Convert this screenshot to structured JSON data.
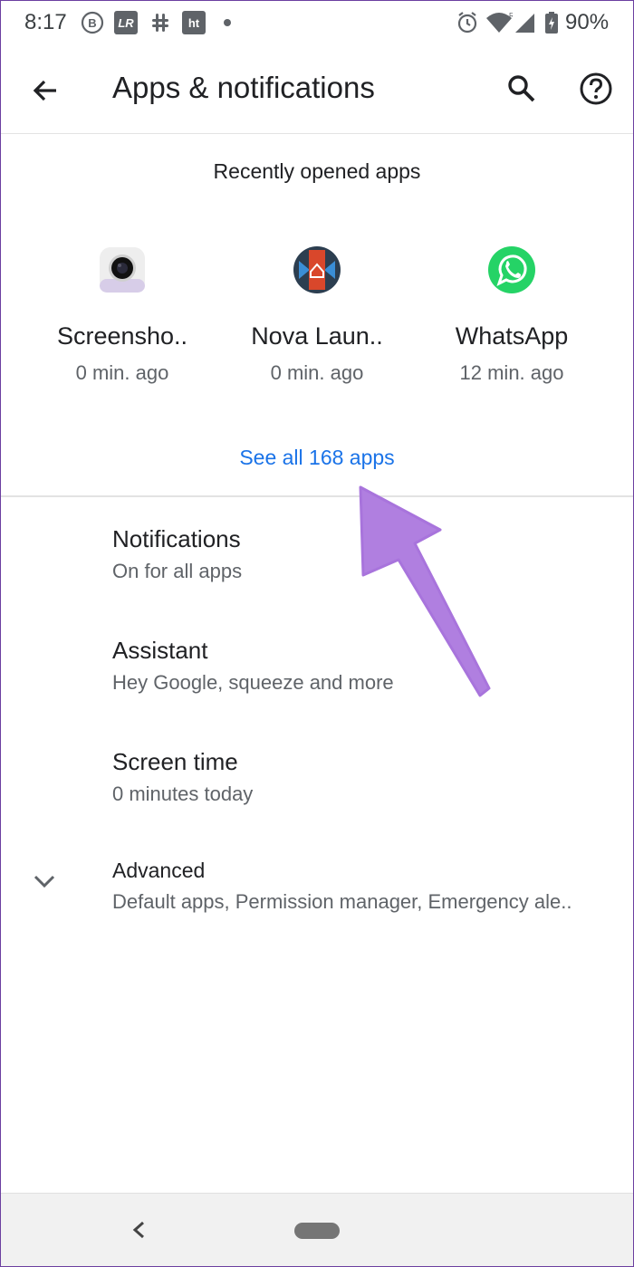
{
  "status_bar": {
    "time": "8:17",
    "badge_lr": "LR",
    "badge_ht": "ht",
    "battery": "90%",
    "icons": [
      "b-circle-icon",
      "lightroom-icon",
      "slack-icon",
      "ht-icon",
      "dot-icon",
      "alarm-icon",
      "wifi-icon",
      "signal-icon",
      "battery-icon"
    ]
  },
  "app_bar": {
    "title": "Apps & notifications",
    "icons": [
      "back-arrow-icon",
      "search-icon",
      "help-icon"
    ]
  },
  "recent": {
    "heading": "Recently opened apps",
    "apps": [
      {
        "name": "Screensho..",
        "time": "0 min. ago",
        "icon": "screenshot-app-icon"
      },
      {
        "name": "Nova Laun..",
        "time": "0 min. ago",
        "icon": "nova-launcher-icon"
      },
      {
        "name": "WhatsApp",
        "time": "12 min. ago",
        "icon": "whatsapp-icon"
      }
    ],
    "see_all": "See all 168 apps"
  },
  "settings": [
    {
      "title": "Notifications",
      "subtitle": "On for all apps"
    },
    {
      "title": "Assistant",
      "subtitle": "Hey Google, squeeze and more"
    },
    {
      "title": "Screen time",
      "subtitle": "0 minutes today"
    },
    {
      "title": "Advanced",
      "subtitle": "Default apps, Permission manager, Emergency ale.."
    }
  ],
  "annotation": {
    "color": "#b07fe0",
    "icon": "annotation-arrow"
  },
  "colors": {
    "accent": "#1a73e8",
    "whatsapp": "#25d366",
    "nova": "#d9472b",
    "annotation": "#b07fe0"
  }
}
